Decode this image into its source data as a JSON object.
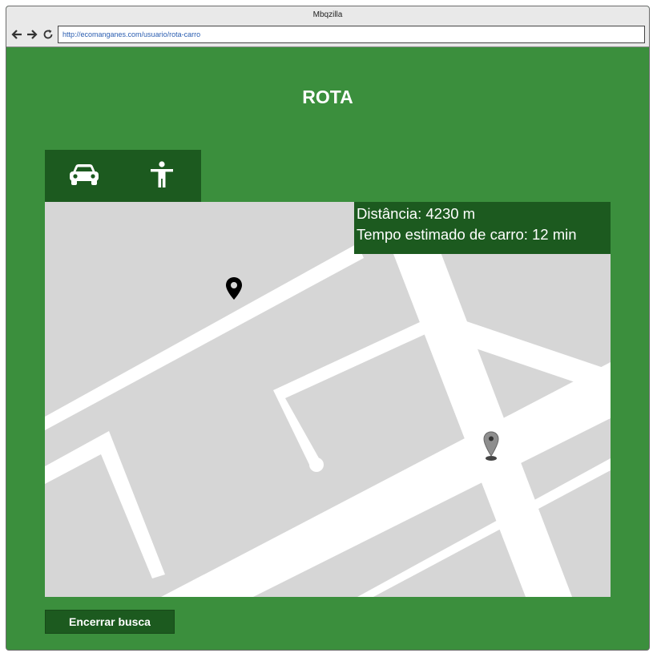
{
  "browser": {
    "window_title": "Mbqzilla",
    "url": "http://ecomanganes.com/usuario/rota-carro"
  },
  "page": {
    "title": "ROTA"
  },
  "mode_tabs": [
    {
      "icon": "car-icon"
    },
    {
      "icon": "pedestrian-icon"
    }
  ],
  "route_info": {
    "distance": "Distância: 4230 m",
    "time": "Tempo estimado de carro: 12 min"
  },
  "map": {
    "markers": [
      {
        "icon": "location-pin-icon",
        "color": "#000000"
      },
      {
        "icon": "map-marker-icon",
        "color": "#8a8a8a"
      }
    ]
  },
  "actions": {
    "end_search_label": "Encerrar busca"
  },
  "colors": {
    "page_background": "#3b8f3d",
    "dark_green": "#1c5a1f",
    "map_background": "#d6d6d6",
    "road": "#ffffff"
  }
}
